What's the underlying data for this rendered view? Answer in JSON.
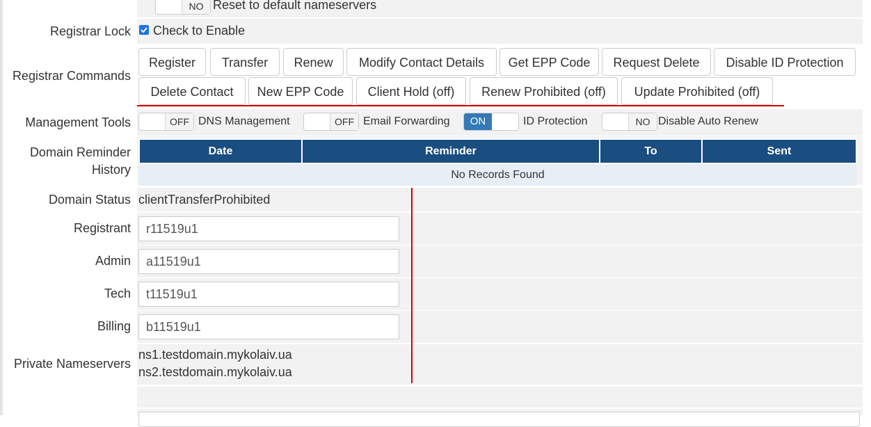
{
  "nameservers_row": {
    "toggle_state": "NO",
    "text": "Reset to default nameservers"
  },
  "registrar_lock": {
    "label": "Registrar Lock",
    "checkbox_text": "Check to Enable",
    "checked": true
  },
  "registrar_commands": {
    "label": "Registrar Commands",
    "buttons_row1": [
      "Register",
      "Transfer",
      "Renew",
      "Modify Contact Details",
      "Get EPP Code",
      "Request Delete",
      "Disable ID Protection"
    ],
    "buttons_row2": [
      "Delete Contact",
      "New EPP Code",
      "Client Hold (off)",
      "Renew Prohibited (off)",
      "Update Prohibited (off)"
    ]
  },
  "management_tools": {
    "label": "Management Tools",
    "items": [
      {
        "state": "OFF",
        "text": "DNS Management",
        "on": false
      },
      {
        "state": "OFF",
        "text": "Email Forwarding",
        "on": false
      },
      {
        "state": "ON",
        "text": "ID Protection",
        "on": true
      },
      {
        "state": "NO",
        "text": "Disable Auto Renew",
        "on": false
      }
    ]
  },
  "reminder_history": {
    "label_line1": "Domain Reminder",
    "label_line2": "History",
    "columns": [
      "Date",
      "Reminder",
      "To",
      "Sent"
    ],
    "empty_text": "No Records Found"
  },
  "domain_status": {
    "label": "Domain Status",
    "value": "clientTransferProhibited"
  },
  "contacts": [
    {
      "label": "Registrant",
      "value": "r11519u1"
    },
    {
      "label": "Admin",
      "value": "a11519u1"
    },
    {
      "label": "Tech",
      "value": "t11519u1"
    },
    {
      "label": "Billing",
      "value": "b11519u1"
    }
  ],
  "private_nameservers": {
    "label": "Private Nameservers",
    "values": [
      "ns1.testdomain.mykolaiv.ua",
      "ns2.testdomain.mykolaiv.ua"
    ]
  },
  "colors": {
    "table_header": "#1a4d80",
    "toggle_on": "#337ab7",
    "annotation": "#d60000"
  }
}
